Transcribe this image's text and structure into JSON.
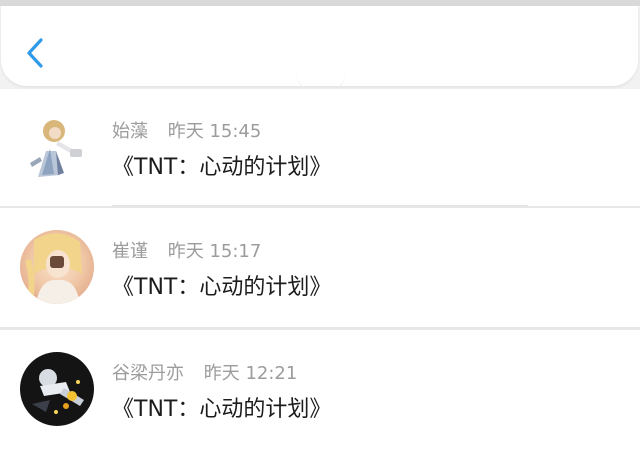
{
  "header": {
    "back_icon": "chevron-left-icon",
    "accent": "#2f9be8"
  },
  "comments": [
    {
      "author": "始藻",
      "time": "昨天 15:45",
      "text": "《TNT：心动的计划》",
      "avatar": "anime-character-avatar"
    },
    {
      "author": "崔谨",
      "time": "昨天 15:17",
      "text": "《TNT：心动的计划》",
      "avatar": "anime-character-avatar"
    },
    {
      "author": "谷梁丹亦",
      "time": "昨天 12:21",
      "text": "《TNT：心动的计划》",
      "avatar": "anime-character-avatar"
    }
  ]
}
